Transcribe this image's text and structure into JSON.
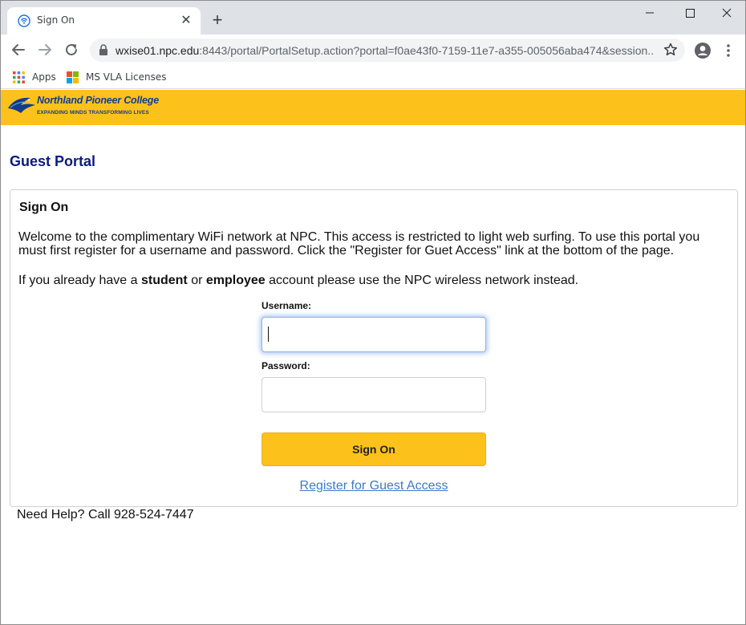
{
  "browser": {
    "tab": {
      "title": "Sign On",
      "close_glyph": "✕",
      "favicon": "globe-wifi-icon"
    },
    "new_tab_glyph": "+",
    "window_controls": {
      "minimize": "—",
      "maximize": "☐",
      "close": "✕"
    },
    "address": {
      "host": "wxise01.npc.edu",
      "rest": ":8443/portal/PortalSetup.action?portal=f0ae43f0-7159-11e7-a355-005056aba474&session..."
    },
    "bookmarks": [
      {
        "label": "Apps",
        "icon": "apps-grid-icon"
      },
      {
        "label": "MS VLA Licenses",
        "icon": "microsoft-logo-icon"
      }
    ]
  },
  "banner": {
    "college_name": "Northland Pioneer College",
    "tagline": "EXPANDING MINDS   TRANSFORMING LIVES"
  },
  "page": {
    "title": "Guest Portal",
    "panel_title": "Sign On",
    "welcome_text": "Welcome to the complimentary WiFi network at NPC. This access is restricted to light web surfing. To use this portal you must first register for a username and password. Click the \"Register for Guet Access\" link at the bottom of the page.",
    "notice": {
      "pre": "If you already have a ",
      "student": "student",
      "mid": " or ",
      "employee": "employee",
      "post": " account please use the NPC wireless network instead."
    },
    "username_label": "Username:",
    "username_value": "",
    "password_label": "Password:",
    "password_value": "",
    "sign_on_button": "Sign On",
    "register_link": "Register for Guest Access",
    "help_text": "Need Help? Call 928-524-7447"
  },
  "colors": {
    "brand_yellow": "#fcc21b",
    "brand_navy": "#0b1a80",
    "link_blue": "#3d7ac8"
  }
}
